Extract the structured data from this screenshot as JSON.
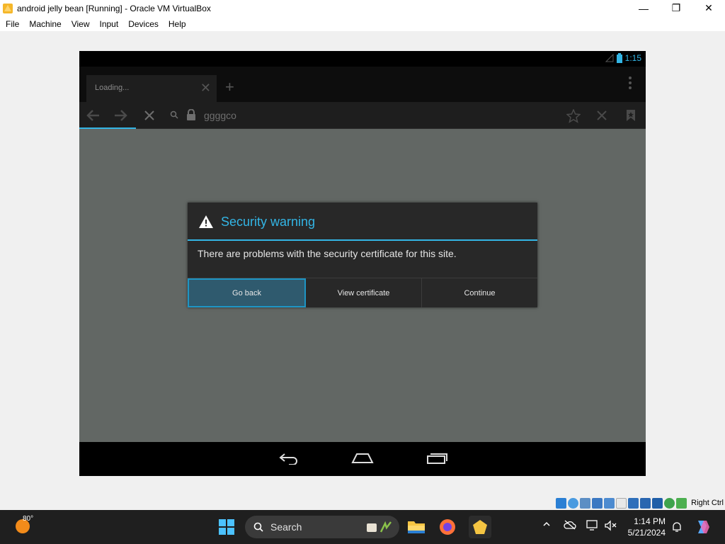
{
  "window": {
    "title": "android jelly bean [Running] - Oracle VM VirtualBox",
    "minimize": "—",
    "maximize": "❐",
    "close": "✕"
  },
  "menu": [
    "File",
    "Machine",
    "View",
    "Input",
    "Devices",
    "Help"
  ],
  "android": {
    "clock": "1:15",
    "tab_label": "Loading...",
    "tab_close": "✕",
    "new_tab": "+",
    "url": "ggggco",
    "progress": 0.1
  },
  "dialog": {
    "title": "Security warning",
    "message": "There are problems with the security certificate for this site.",
    "buttons": [
      "Go back",
      "View certificate",
      "Continue"
    ]
  },
  "vbox_status": {
    "right_ctrl": "Right Ctrl"
  },
  "taskbar": {
    "temperature": "80°",
    "search": "Search",
    "time": "1:14 PM",
    "date": "5/21/2024"
  },
  "colors": {
    "accent": "#33b5e5",
    "content_bg": "#626764",
    "dialog_bg": "#282828",
    "taskbar_bg": "#1f1f1f"
  }
}
